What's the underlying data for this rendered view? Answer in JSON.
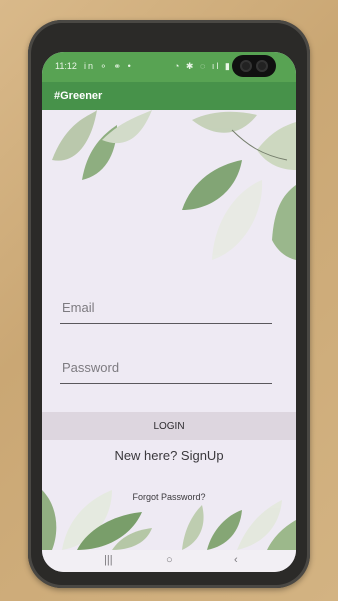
{
  "status_bar": {
    "time": "11:12",
    "left_icons": "in ⚬ ⚭ •",
    "right_icons": "◔ ✱ ◌ ıl ▮"
  },
  "app_bar": {
    "title": "#Greener"
  },
  "form": {
    "email_placeholder": "Email",
    "password_placeholder": "Password"
  },
  "actions": {
    "login_label": "LOGIN",
    "signup_label": "New here? SignUp",
    "forgot_label": "Forgot Password?"
  },
  "nav": {
    "recents": "|||",
    "home": "○",
    "back": "‹"
  },
  "colors": {
    "status_bar": "#58a353",
    "app_bar": "#47924a",
    "screen_background": "#eeeaf3",
    "login_button": "#ddd6df"
  }
}
